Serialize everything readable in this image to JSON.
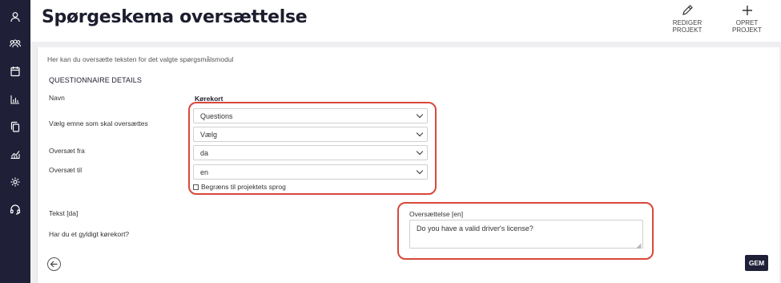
{
  "sidebar": {
    "icons": [
      "user-icon",
      "users-group-icon",
      "calendar-icon",
      "bar-chart-icon",
      "copy-icon",
      "line-chart-icon",
      "gear-icon",
      "headset-icon"
    ]
  },
  "header": {
    "title": "Spørgeskema oversættelse",
    "edit_project_label": "REDIGER PROJEKT",
    "create_project_label": "OPRET PROJEKT"
  },
  "main": {
    "intro": "Her kan du oversætte teksten for det valgte spørgsmålsmodul",
    "section_title": "QUESTIONNAIRE DETAILS",
    "name_label": "Navn",
    "name_value": "Kørekort",
    "topic_label": "Vælg emne som skal oversættes",
    "topic_select_1": "Questions",
    "topic_select_2": "Vælg",
    "from_label": "Oversæt fra",
    "from_value": "da",
    "to_label": "Oversæt til",
    "to_value": "en",
    "limit_checkbox_label": "Begræns til projektets sprog",
    "limit_checkbox_checked": false,
    "text_label": "Tekst [da]",
    "question_text": "Har du et gyldigt kørekort?",
    "translation_label": "Oversættelse [en]",
    "translation_value": "Do you have a valid driver's license?",
    "save_label": "GEM"
  },
  "colors": {
    "sidebar_bg": "#1f2038",
    "highlight_red": "#d9483b",
    "save_button_bg": "#1f2038"
  }
}
